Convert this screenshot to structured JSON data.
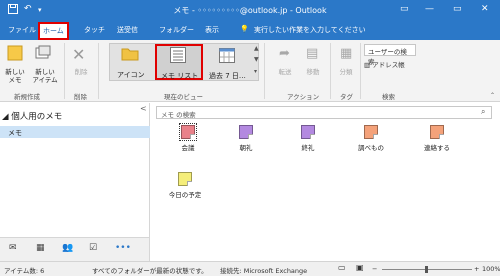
{
  "titlebar": {
    "title": "メモ - ◦◦◦◦◦◦◦◦◦@outlook.jp - Outlook",
    "save_icon": "save-icon",
    "undo_icon": "undo-icon",
    "customize_icon": "dropdown-icon",
    "ribbon_display": "▭",
    "minimize": "—",
    "restore": "▭",
    "close": "✕"
  },
  "tabs": [
    {
      "label": "ファイル"
    },
    {
      "label": "ホーム"
    },
    {
      "label": "タッチ"
    },
    {
      "label": "送受信"
    },
    {
      "label": "フォルダー"
    },
    {
      "label": "表示"
    }
  ],
  "tellme": "実行したい作業を入力してください",
  "ribbon": {
    "new_note": "新しい\nメモ",
    "new_item": "新しい\nアイテム",
    "delete": "削除",
    "view_icon": "アイコン",
    "view_list": "メモ リスト",
    "view_last7": "過去 7 日…",
    "forward": "転送",
    "move": "移動",
    "categorize": "分類",
    "search_people": "ユーザーの検索",
    "address_book": "アドレス帳",
    "groups": {
      "new": "新規作成",
      "delete": "削除",
      "current_view": "現在のビュー",
      "actions": "アクション",
      "tags": "タグ",
      "find": "検索"
    }
  },
  "nav": {
    "header": "個人用のメモ",
    "folder": "メモ",
    "collapse": "<"
  },
  "search_placeholder": "メモ の検索",
  "notes": [
    {
      "label": "会議",
      "color": "#e9818a"
    },
    {
      "label": "朝礼",
      "color": "#b389e0"
    },
    {
      "label": "終礼",
      "color": "#b389e0"
    },
    {
      "label": "調べもの",
      "color": "#f4a27a"
    },
    {
      "label": "連絡する",
      "color": "#f4a27a"
    },
    {
      "label": "今日の予定",
      "color": "#f5ee7a"
    }
  ],
  "bottom_nav": {
    "more": "•••"
  },
  "status": {
    "items": "アイテム数: 6",
    "folders": "すべてのフォルダーが最新の状態です。",
    "connection": "接続先: Microsoft Exchange",
    "zoom": "100%"
  },
  "colors": {
    "accent": "#2b78c8",
    "highlight": "#e00000",
    "selection": "#cde3f7"
  }
}
